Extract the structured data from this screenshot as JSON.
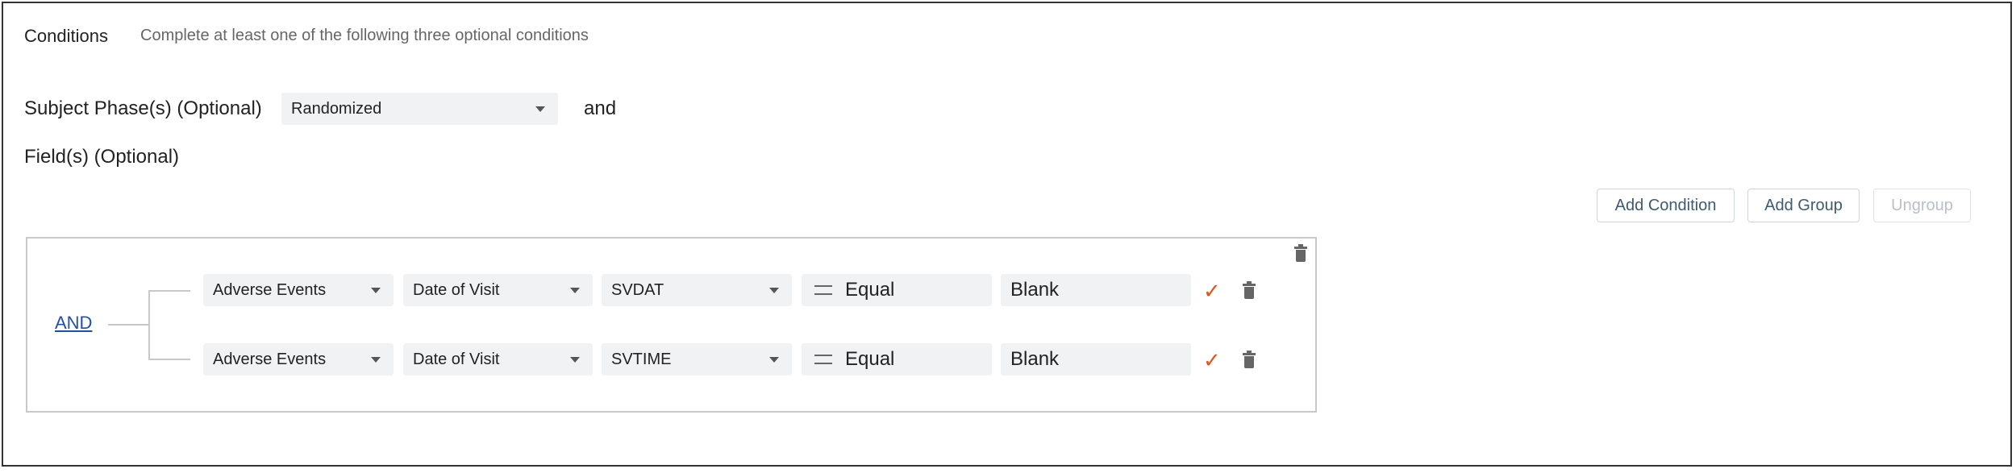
{
  "conditions": {
    "title": "Conditions",
    "hint": "Complete at least one of the following three optional conditions"
  },
  "phase": {
    "label": "Subject Phase(s) (Optional)",
    "selected": "Randomized",
    "joiner": "and"
  },
  "fields": {
    "label": "Field(s) (Optional)"
  },
  "toolbar": {
    "add_condition": "Add Condition",
    "add_group": "Add Group",
    "ungroup": "Ungroup"
  },
  "group": {
    "operator": "AND",
    "rows": [
      {
        "form": "Adverse Events",
        "event": "Date of Visit",
        "field": "SVDAT",
        "operator": "Equal",
        "value": "Blank"
      },
      {
        "form": "Adverse Events",
        "event": "Date of Visit",
        "field": "SVTIME",
        "operator": "Equal",
        "value": "Blank"
      }
    ]
  },
  "icons": {
    "confirm": "check-icon",
    "delete": "trash-icon",
    "dropdown": "caret-down-icon",
    "equals": "equals-icon"
  },
  "colors": {
    "link": "#1f4fb3",
    "confirm": "#e8521a",
    "field_bg": "#f1f2f4",
    "button_text": "#3d5a73"
  }
}
